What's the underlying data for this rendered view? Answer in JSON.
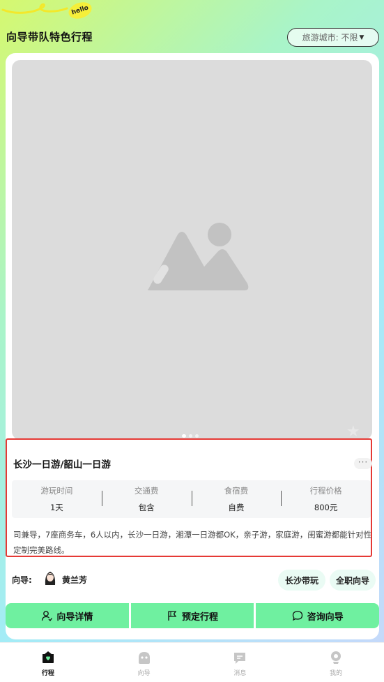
{
  "header": {
    "badge": "hello",
    "title": "向导带队特色行程",
    "city_select": "旅游城市: 不限"
  },
  "trip": {
    "title": "长沙一日游/韶山一日游",
    "more": "···",
    "stats": [
      {
        "label": "游玩时间",
        "value": "1天"
      },
      {
        "label": "交通费",
        "value": "包含"
      },
      {
        "label": "食宿费",
        "value": "自费"
      },
      {
        "label": "行程价格",
        "value": "800元"
      }
    ],
    "description": "司兼导，7座商务车，6人以内，长沙一日游，湘潭一日游都OK，亲子游，家庭游，闺蜜游都能针对性定制完美路线。"
  },
  "guide": {
    "label": "向导:",
    "name": "黄兰芳",
    "tags": [
      "长沙带玩",
      "全职向导"
    ]
  },
  "actions": {
    "detail": "向导详情",
    "book": "预定行程",
    "consult": "咨询向导"
  },
  "tabbar": {
    "items": [
      {
        "label": "行程",
        "icon": "trip-icon"
      },
      {
        "label": "向导",
        "icon": "guide-icon"
      },
      {
        "label": "消息",
        "icon": "message-icon"
      },
      {
        "label": "我的",
        "icon": "profile-icon"
      }
    ],
    "active": "行程"
  },
  "colors": {
    "accent": "#6ff0a0",
    "highlight_border": "#e53935",
    "annotation_arrow": "#f03a3a"
  }
}
